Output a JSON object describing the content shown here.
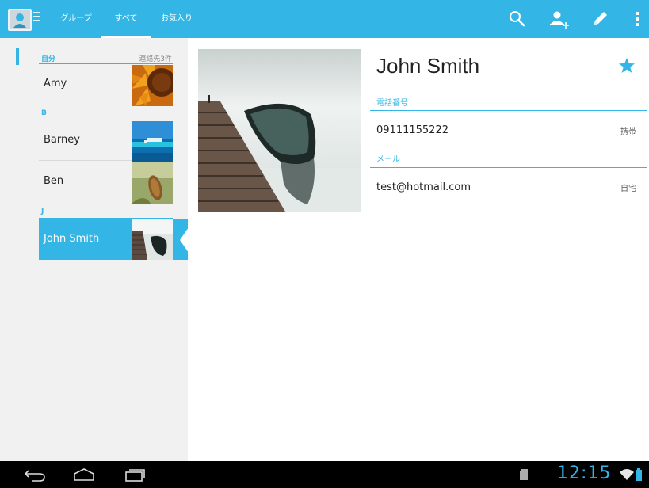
{
  "action_bar": {
    "tabs": [
      {
        "label": "グループ"
      },
      {
        "label": "すべて"
      },
      {
        "label": "お気入り"
      }
    ],
    "active_tab": "すべて",
    "actions": [
      "search-icon",
      "add-contact-icon",
      "edit-icon",
      "overflow-menu-icon"
    ]
  },
  "contact_list": {
    "me_header": {
      "label": "自分",
      "count": "連絡先3件"
    },
    "sections": [
      {
        "letter": "B"
      },
      {
        "letter": "J"
      }
    ],
    "contacts": [
      {
        "name": "Amy"
      },
      {
        "name": "Barney"
      },
      {
        "name": "Ben"
      },
      {
        "name": "John Smith"
      }
    ]
  },
  "detail": {
    "name": "John Smith",
    "starred": true,
    "phone_section": "電話番号",
    "phone": {
      "value": "09111155222",
      "type": "携帯"
    },
    "email_section": "メール",
    "email": {
      "value": "test@hotmail.com",
      "type": "自宅"
    }
  },
  "system_bar": {
    "time": "12:15"
  },
  "colors": {
    "accent": "#33b5e5",
    "list_bg": "#f1f1f1",
    "navbar": "#000000"
  }
}
